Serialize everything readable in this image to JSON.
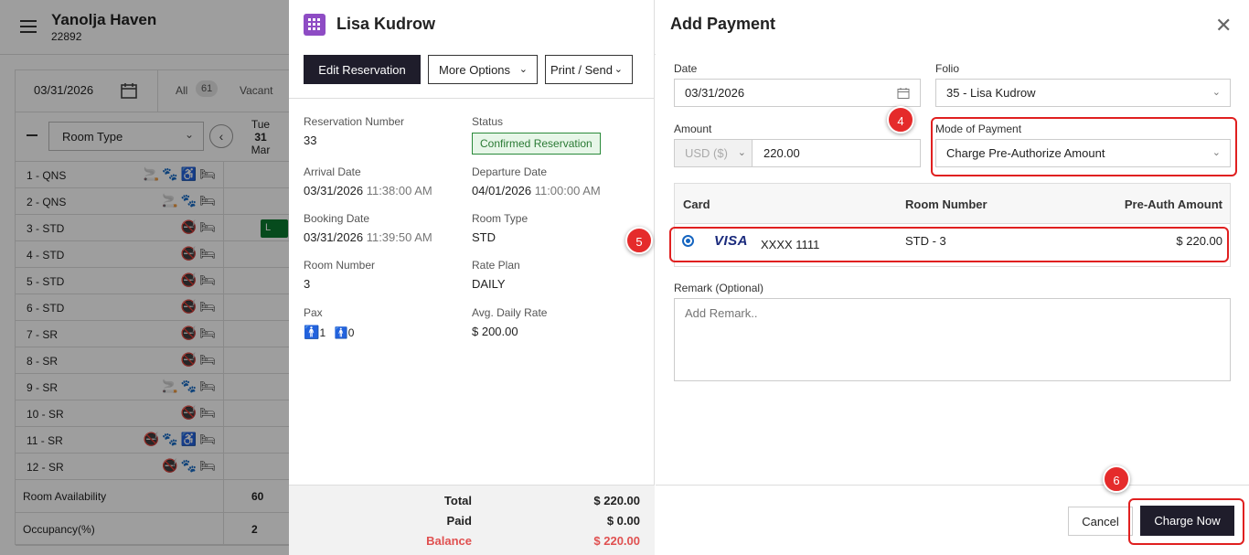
{
  "hotel": {
    "name": "Yanolja Haven",
    "id": "22892"
  },
  "calendar": {
    "date": "03/31/2026",
    "filter_all": "All",
    "filter_all_count": "61",
    "filter_vacant": "Vacant",
    "room_type_label": "Room Type",
    "day": {
      "weekday": "Tue",
      "day": "31",
      "month": "Mar"
    },
    "rooms": [
      {
        "name": "1 - QNS",
        "icons": "🚬🐾♿🛏"
      },
      {
        "name": "2 - QNS",
        "icons": "🚬🐾🛏"
      },
      {
        "name": "3 - STD",
        "icons": "🚭🛏",
        "res": "L"
      },
      {
        "name": "4 - STD",
        "icons": "🚭🛏"
      },
      {
        "name": "5 - STD",
        "icons": "🚭🛏"
      },
      {
        "name": "6 - STD",
        "icons": "🚭🛏"
      },
      {
        "name": "7 - SR",
        "icons": "🚭🛏"
      },
      {
        "name": "8 - SR",
        "icons": "🚭🛏"
      },
      {
        "name": "9 - SR",
        "icons": "🚬🐾🛏"
      },
      {
        "name": "10 - SR",
        "icons": "🚭🛏"
      },
      {
        "name": "11 - SR",
        "icons": "🚭🐾♿🛏"
      },
      {
        "name": "12 - SR",
        "icons": "🚭🐾🛏"
      }
    ],
    "room_availability_label": "Room Availability",
    "room_availability_value": "60",
    "occupancy_label": "Occupancy(%)",
    "occupancy_value": "2"
  },
  "reservation": {
    "guest_name": "Lisa Kudrow",
    "edit_button": "Edit Reservation",
    "more_options_button": "More Options",
    "print_send_button": "Print / Send",
    "reservation_number_label": "Reservation Number",
    "reservation_number": "33",
    "status_label": "Status",
    "status": "Confirmed Reservation",
    "arrival_label": "Arrival Date",
    "arrival_date": "03/31/2026",
    "arrival_time": "11:38:00 AM",
    "departure_label": "Departure Date",
    "departure_date": "04/01/2026",
    "departure_time": "11:00:00 AM",
    "booking_label": "Booking Date",
    "booking_date": "03/31/2026",
    "booking_time": "11:39:50 AM",
    "room_type_label": "Room Type",
    "room_type": "STD",
    "room_number_label": "Room Number",
    "room_number": "3",
    "rate_plan_label": "Rate Plan",
    "rate_plan": "DAILY",
    "pax_label": "Pax",
    "pax_adults": "1",
    "pax_children": "0",
    "adr_label": "Avg. Daily Rate",
    "adr": "$ 200.00",
    "total_label": "Total",
    "total": "$ 220.00",
    "paid_label": "Paid",
    "paid": "$ 0.00",
    "balance_label": "Balance",
    "balance": "$ 220.00"
  },
  "payment": {
    "title": "Add Payment",
    "date_label": "Date",
    "date_value": "03/31/2026",
    "folio_label": "Folio",
    "folio_value": "35 - Lisa Kudrow",
    "amount_label": "Amount",
    "currency": "USD ($)",
    "amount_value": "220.00",
    "mode_label": "Mode of Payment",
    "mode_value": "Charge Pre-Authorize Amount",
    "table": {
      "headers": [
        "Card",
        "Room Number",
        "Pre-Auth Amount"
      ],
      "row": {
        "brand": "VISA",
        "card": "XXXX 1111",
        "room": "STD - 3",
        "amount": "$ 220.00"
      }
    },
    "remark_label": "Remark (Optional)",
    "remark_placeholder": "Add Remark..",
    "cancel_button": "Cancel",
    "charge_button": "Charge Now",
    "steps": [
      "4",
      "5",
      "6"
    ]
  },
  "colors": {
    "primary_dark": "#1f1d2b",
    "annotation_red": "#e02020",
    "status_green": "#2a8a3a",
    "balance_red": "#e05050",
    "visa_blue": "#1a2a7c"
  }
}
